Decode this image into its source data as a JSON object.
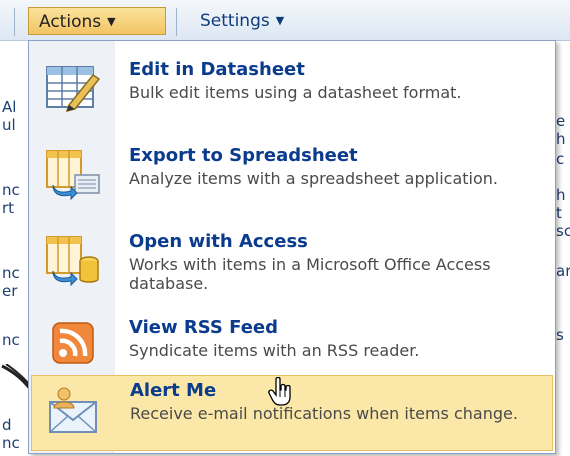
{
  "toolbar": {
    "actions_label": "Actions",
    "settings_label": "Settings"
  },
  "background": {
    "left_fragments": [
      "Al",
      "ul",
      "nc",
      "rt",
      "nc",
      "er",
      "nc",
      "d",
      "nc"
    ],
    "right_fragments": [
      "e",
      "h",
      "c",
      "h",
      "t",
      "sc",
      "ar",
      "s"
    ]
  },
  "menu": {
    "items": [
      {
        "title": "Edit in Datasheet",
        "description": "Bulk edit items using a datasheet format.",
        "icon": "datasheet-icon"
      },
      {
        "title": "Export to Spreadsheet",
        "description": "Analyze items with a spreadsheet application.",
        "icon": "spreadsheet-icon"
      },
      {
        "title": "Open with Access",
        "description": "Works with items in a Microsoft Office Access database.",
        "icon": "access-icon"
      },
      {
        "title": "View RSS Feed",
        "description": "Syndicate items with an RSS reader.",
        "icon": "rss-icon"
      },
      {
        "title": "Alert Me",
        "description": "Receive e-mail notifications when items change.",
        "icon": "alert-icon"
      }
    ],
    "highlighted_item": "Alert Me"
  },
  "colors": {
    "title": "#0a3b8c",
    "highlight": "#fbe8a8",
    "rss": "#f0873a"
  }
}
